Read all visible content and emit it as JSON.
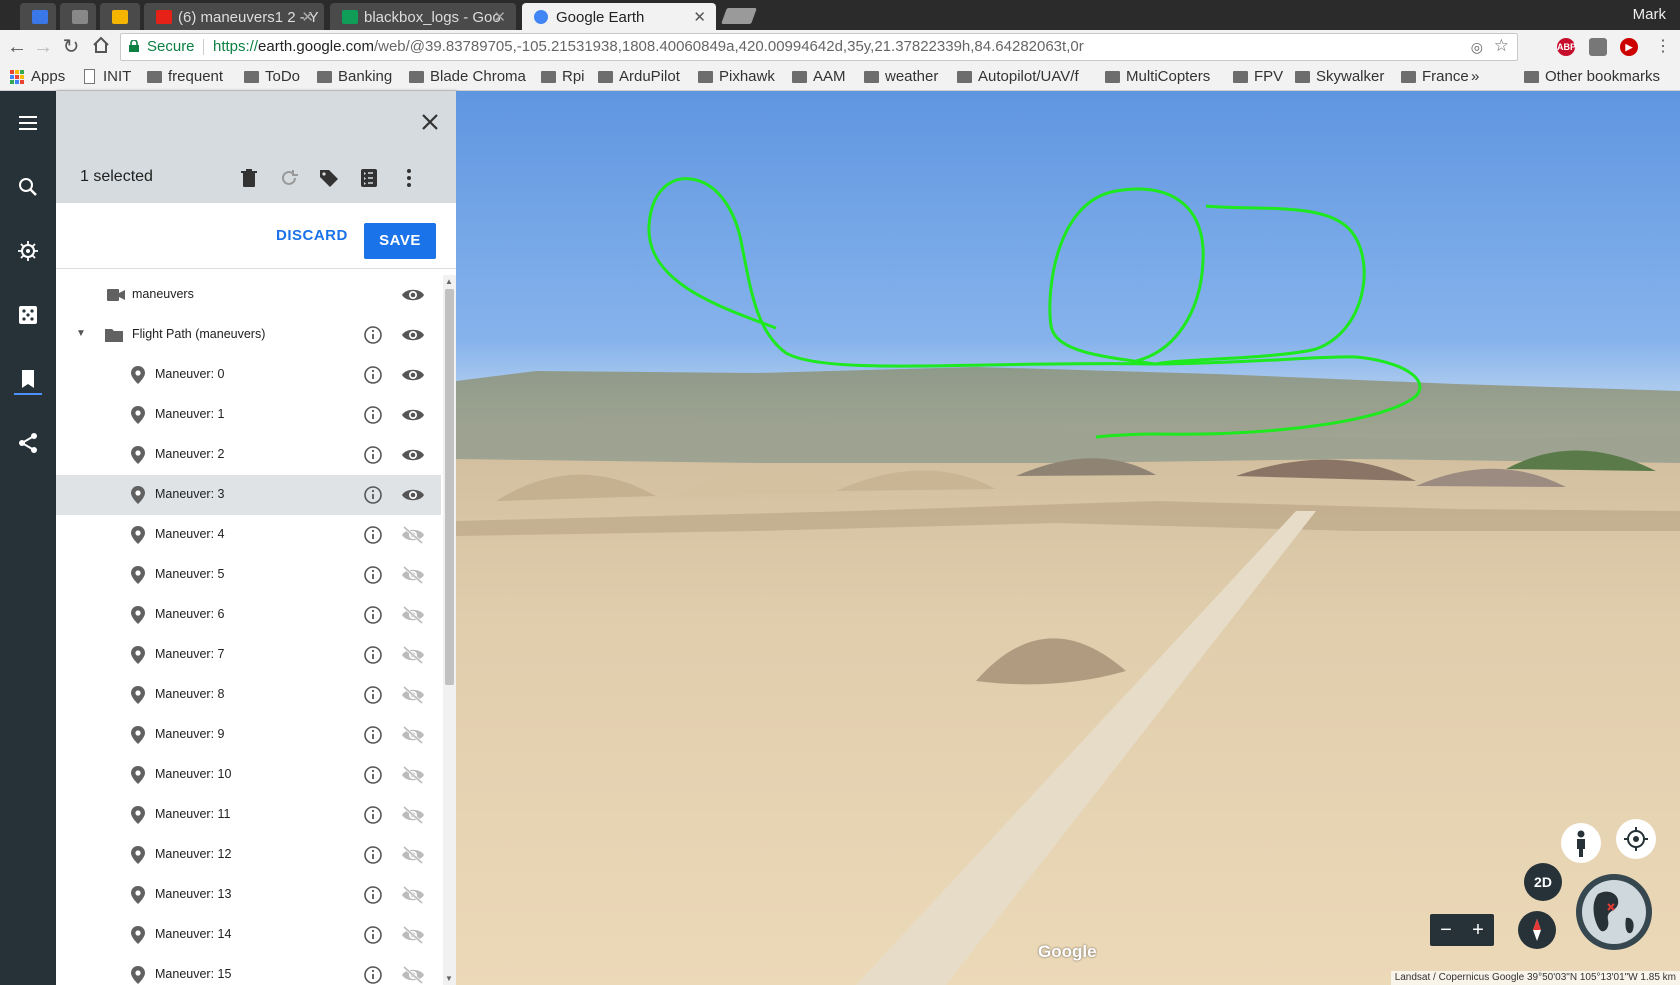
{
  "browser": {
    "tabs": [
      {
        "label": "",
        "favicon_color": "#3b78e7"
      },
      {
        "label": "",
        "favicon_color": "#888888"
      },
      {
        "label": "",
        "favicon_color": "#f4b400"
      },
      {
        "label": "(6) maneuvers1 2 - Y",
        "favicon_color": "#e62117"
      },
      {
        "label": "blackbox_logs - Goo",
        "favicon_color": "#0f9d58"
      },
      {
        "label": "Google Earth",
        "favicon_color": "#4285f4"
      }
    ],
    "user": "Mark",
    "secure_label": "Secure",
    "url_scheme": "https://",
    "url_host": "earth.google.com",
    "url_rest": "/web/@39.83789705,-105.21531938,1808.40060849a,420.00994642d,35y,21.37822339h,84.64282063t,0r",
    "extensions": [
      {
        "label": "ABP",
        "color": "#c70d2c"
      },
      {
        "label": "",
        "color": "#777777"
      },
      {
        "label": "",
        "color": "#cc0000"
      }
    ],
    "bookmarks": [
      {
        "label": "Apps",
        "kind": "apps"
      },
      {
        "label": "INIT",
        "kind": "page"
      },
      {
        "label": "frequent",
        "kind": "folder"
      },
      {
        "label": "ToDo",
        "kind": "folder"
      },
      {
        "label": "Banking",
        "kind": "folder"
      },
      {
        "label": "Blade Chroma",
        "kind": "folder"
      },
      {
        "label": "Rpi",
        "kind": "folder"
      },
      {
        "label": "ArduPilot",
        "kind": "folder"
      },
      {
        "label": "Pixhawk",
        "kind": "folder"
      },
      {
        "label": "AAM",
        "kind": "folder"
      },
      {
        "label": "weather",
        "kind": "folder"
      },
      {
        "label": "Autopilot/UAV/f",
        "kind": "folder"
      },
      {
        "label": "MultiCopters",
        "kind": "folder"
      },
      {
        "label": "FPV",
        "kind": "folder"
      },
      {
        "label": "Skywalker",
        "kind": "folder"
      },
      {
        "label": "France",
        "kind": "folder"
      },
      {
        "label": "»",
        "kind": "more"
      },
      {
        "label": "Other bookmarks",
        "kind": "folder"
      }
    ]
  },
  "rail": {
    "items": [
      "menu-icon",
      "search-icon",
      "voyager-icon",
      "feeling-lucky-icon",
      "projects-icon",
      "share-icon"
    ]
  },
  "panel": {
    "selected_count": "1 selected",
    "discard_label": "DISCARD",
    "save_label": "SAVE",
    "items": [
      {
        "label": "maneuvers",
        "kind": "tour",
        "info": false,
        "visible": true,
        "indent": 0
      },
      {
        "label": "Flight Path (maneuvers)",
        "kind": "folder",
        "info": true,
        "visible": true,
        "indent": 0
      },
      {
        "label": "Maneuver: 0",
        "kind": "placemark",
        "info": true,
        "visible": true,
        "indent": 1
      },
      {
        "label": "Maneuver: 1",
        "kind": "placemark",
        "info": true,
        "visible": true,
        "indent": 1
      },
      {
        "label": "Maneuver: 2",
        "kind": "placemark",
        "info": true,
        "visible": true,
        "indent": 1
      },
      {
        "label": "Maneuver: 3",
        "kind": "placemark",
        "info": true,
        "visible": true,
        "indent": 1,
        "highlighted": true
      },
      {
        "label": "Maneuver: 4",
        "kind": "placemark",
        "info": true,
        "visible": false,
        "indent": 1
      },
      {
        "label": "Maneuver: 5",
        "kind": "placemark",
        "info": true,
        "visible": false,
        "indent": 1
      },
      {
        "label": "Maneuver: 6",
        "kind": "placemark",
        "info": true,
        "visible": false,
        "indent": 1
      },
      {
        "label": "Maneuver: 7",
        "kind": "placemark",
        "info": true,
        "visible": false,
        "indent": 1
      },
      {
        "label": "Maneuver: 8",
        "kind": "placemark",
        "info": true,
        "visible": false,
        "indent": 1
      },
      {
        "label": "Maneuver: 9",
        "kind": "placemark",
        "info": true,
        "visible": false,
        "indent": 1
      },
      {
        "label": "Maneuver: 10",
        "kind": "placemark",
        "info": true,
        "visible": false,
        "indent": 1
      },
      {
        "label": "Maneuver: 11",
        "kind": "placemark",
        "info": true,
        "visible": false,
        "indent": 1
      },
      {
        "label": "Maneuver: 12",
        "kind": "placemark",
        "info": true,
        "visible": false,
        "indent": 1
      },
      {
        "label": "Maneuver: 13",
        "kind": "placemark",
        "info": true,
        "visible": false,
        "indent": 1
      },
      {
        "label": "Maneuver: 14",
        "kind": "placemark",
        "info": true,
        "visible": false,
        "indent": 1
      },
      {
        "label": "Maneuver: 15",
        "kind": "placemark",
        "info": true,
        "visible": false,
        "indent": 1
      }
    ]
  },
  "map": {
    "mode_2d_label": "2D",
    "zoom_out_label": "−",
    "zoom_in_label": "+",
    "watermark": "Google",
    "attribution": "Landsat / Copernicus   Google     39°50'03\"N 105°13'01\"W    1.85 km",
    "flight_path_color": "#1ee81e"
  }
}
